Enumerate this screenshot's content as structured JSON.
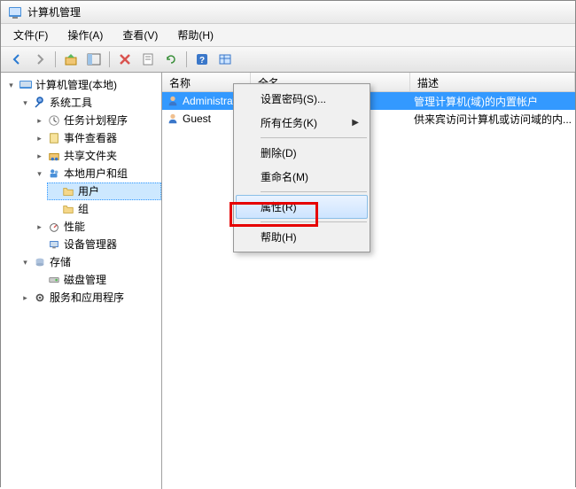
{
  "window": {
    "title": "计算机管理"
  },
  "menubar": {
    "file": "文件(F)",
    "action": "操作(A)",
    "view": "查看(V)",
    "help": "帮助(H)"
  },
  "tree": {
    "root": "计算机管理(本地)",
    "system_tools": "系统工具",
    "task_scheduler": "任务计划程序",
    "event_viewer": "事件查看器",
    "shared_folders": "共享文件夹",
    "local_users": "本地用户和组",
    "users": "用户",
    "groups": "组",
    "performance": "性能",
    "device_manager": "设备管理器",
    "storage": "存储",
    "disk_mgmt": "磁盘管理",
    "services_apps": "服务和应用程序"
  },
  "columns": {
    "name": "名称",
    "fullname": "全名",
    "desc": "描述"
  },
  "users_list": [
    {
      "name": "Administrat...",
      "fullname": "",
      "desc": "管理计算机(域)的内置帐户"
    },
    {
      "name": "Guest",
      "fullname": "",
      "desc": "供来宾访问计算机或访问域的内..."
    }
  ],
  "context_menu": {
    "set_password": "设置密码(S)...",
    "all_tasks": "所有任务(K)",
    "delete": "删除(D)",
    "rename": "重命名(M)",
    "properties": "属性(R)",
    "help": "帮助(H)"
  }
}
